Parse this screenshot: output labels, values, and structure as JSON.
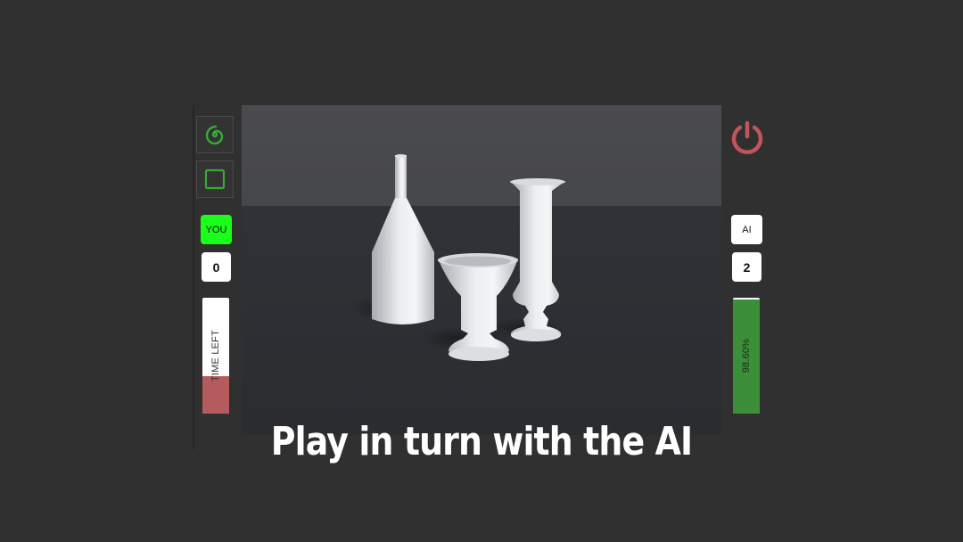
{
  "tools": [
    {
      "icon": "spiral-icon",
      "color": "#3aa83a"
    },
    {
      "icon": "square-icon",
      "color": "#3aa83a"
    }
  ],
  "power": {
    "icon": "power-icon",
    "color": "#c0555a"
  },
  "player": {
    "label": "YOU",
    "score": "0",
    "color": "#19ff19"
  },
  "ai": {
    "label": "AI",
    "score": "2"
  },
  "time_left": {
    "label": "TIME LEFT",
    "fraction_remaining": 0.32,
    "color": "#b55a5d"
  },
  "similarity": {
    "label": "98.60%",
    "fraction": 0.986,
    "color": "#3a8f38"
  },
  "caption": "Play in turn with the AI"
}
